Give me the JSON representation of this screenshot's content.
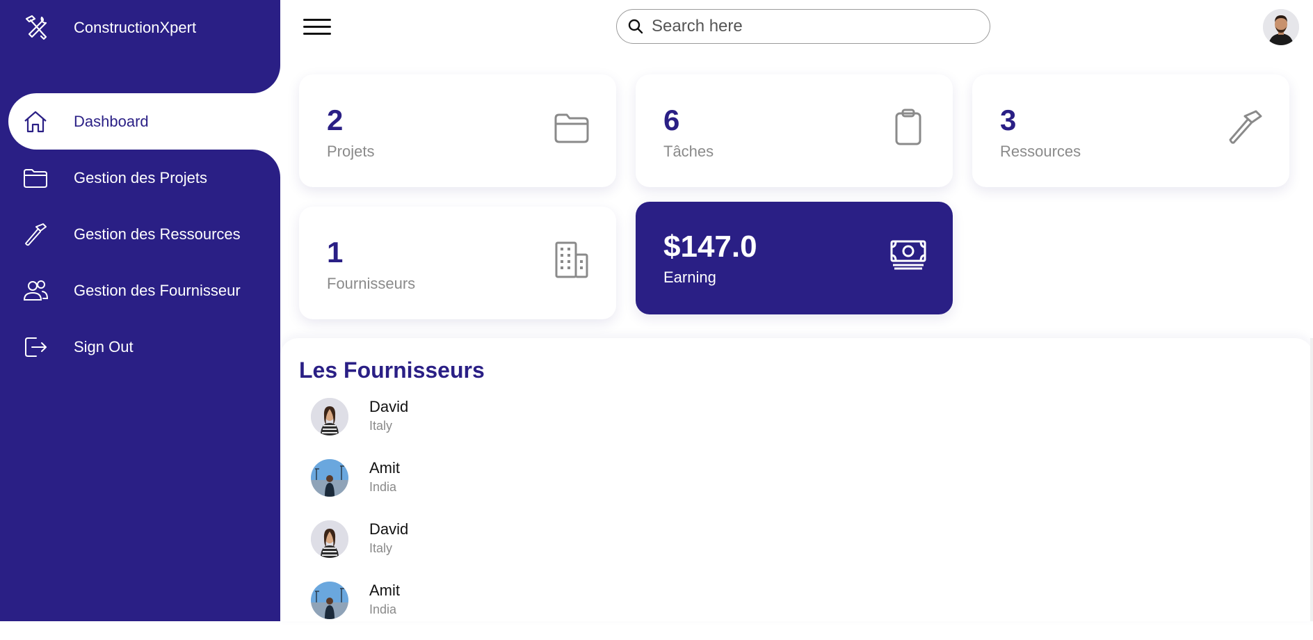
{
  "brand": {
    "title": "ConstructionXpert",
    "icon": "tools-icon"
  },
  "sidebar": {
    "items": [
      {
        "label": "Dashboard",
        "icon": "home-icon",
        "active": true
      },
      {
        "label": "Gestion des Projets",
        "icon": "folder-icon",
        "active": false
      },
      {
        "label": "Gestion des Ressources",
        "icon": "hammer-icon",
        "active": false
      },
      {
        "label": "Gestion des Fournisseur",
        "icon": "users-icon",
        "active": false
      },
      {
        "label": "Sign Out",
        "icon": "sign-out-icon",
        "active": false
      }
    ]
  },
  "topbar": {
    "search_placeholder": "Search here"
  },
  "cards": [
    {
      "value": "2",
      "label": "Projets",
      "icon": "folder-icon"
    },
    {
      "value": "6",
      "label": "Tâches",
      "icon": "clipboard-icon"
    },
    {
      "value": "3",
      "label": "Ressources",
      "icon": "hammer-icon"
    },
    {
      "value": "1",
      "label": "Fournisseurs",
      "icon": "building-icon"
    },
    {
      "value": "$147.0",
      "label": "Earning",
      "icon": "money-icon"
    }
  ],
  "suppliers": {
    "title": "Les Fournisseurs",
    "items": [
      {
        "name": "David",
        "country": "Italy"
      },
      {
        "name": "Amit",
        "country": "India"
      },
      {
        "name": "David",
        "country": "Italy"
      },
      {
        "name": "Amit",
        "country": "India"
      }
    ]
  },
  "colors": {
    "brand": "#2a1f85",
    "muted": "#8a8a8a",
    "background": "#ffffff"
  }
}
